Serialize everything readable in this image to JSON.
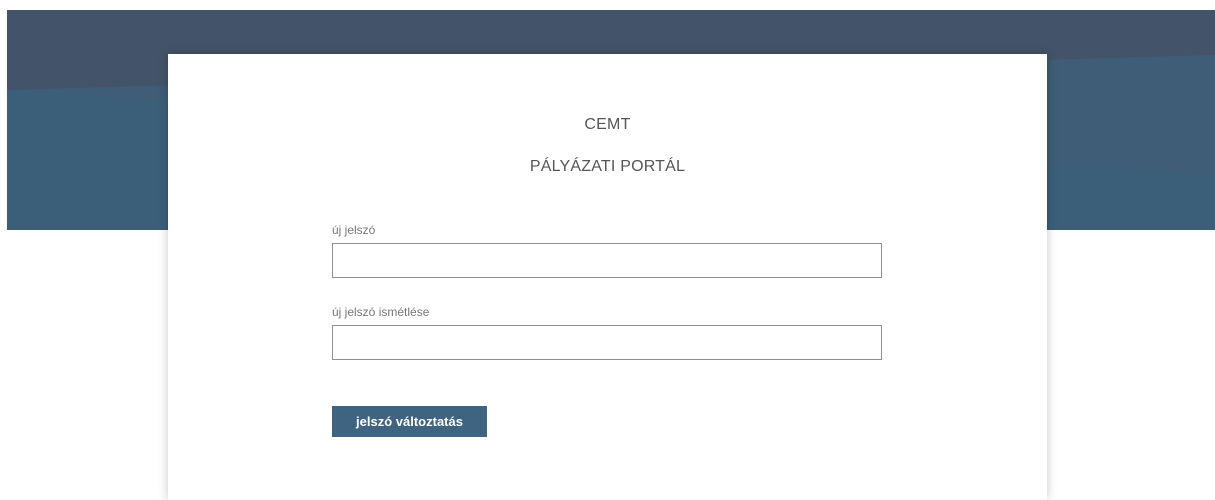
{
  "colors": {
    "banner_top": "#44546a",
    "banner_bottom": "#3f5f78",
    "button": "#3f6481",
    "page": "#ffffff"
  },
  "header": {
    "title": "CEMT",
    "subtitle": "PÁLYÁZATI PORTÁL"
  },
  "form": {
    "new_password_label": "új jelszó",
    "new_password_value": "",
    "repeat_password_label": "új jelszó ismétlése",
    "repeat_password_value": "",
    "submit_label": "jelszó változtatás"
  }
}
